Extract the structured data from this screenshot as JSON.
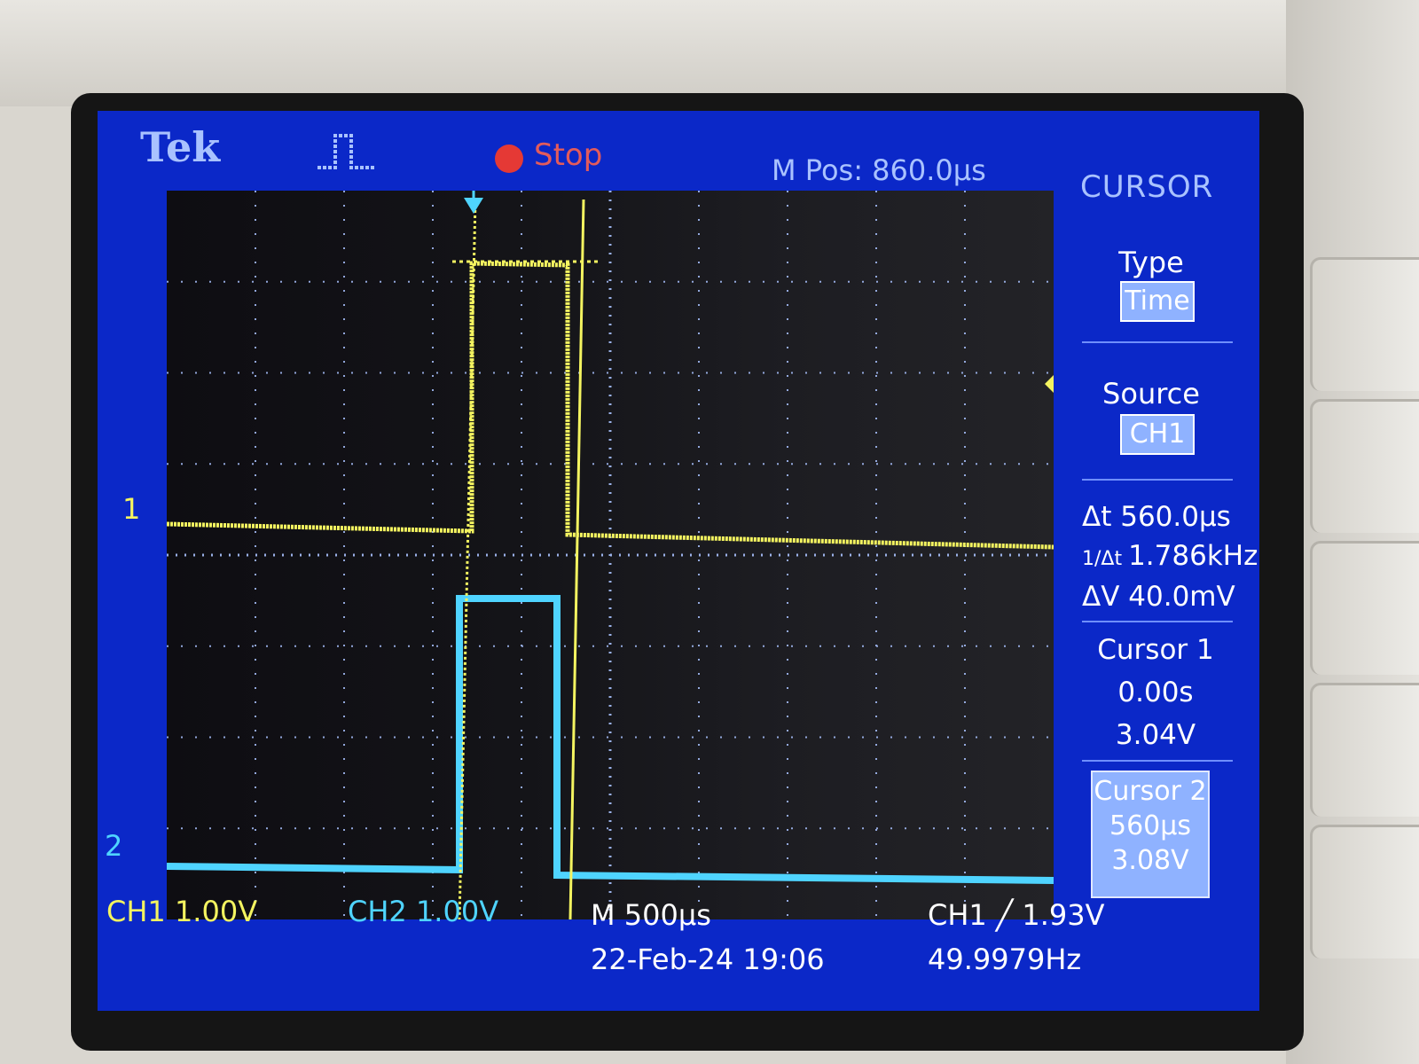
{
  "header": {
    "brand": "Tek",
    "acquisition_state": "Stop",
    "m_pos": "M Pos: 860.0µs"
  },
  "menu": {
    "title": "CURSOR",
    "type_label": "Type",
    "type_value": "Time",
    "source_label": "Source",
    "source_value": "CH1",
    "delta_t": "Δt 560.0µs",
    "inv_delta_t": "1.786kHz",
    "delta_v": "ΔV 40.0mV",
    "cursor1_label": "Cursor 1",
    "cursor1_time": "0.00s",
    "cursor1_volt": "3.04V",
    "cursor2_label": "Cursor 2",
    "cursor2_time": "560µs",
    "cursor2_volt": "3.08V"
  },
  "footer": {
    "ch1_scale": "CH1  1.00V",
    "ch2_scale": "CH2  1.00V",
    "timebase": "M 500µs",
    "datetime": "22-Feb-24 19:06",
    "trigger": "CH1 ╱ 1.93V",
    "frequency": "49.9979Hz"
  },
  "markers": {
    "ch1": "1",
    "ch2": "2"
  },
  "colors": {
    "ch1": "#f4f460",
    "ch2": "#4fd4ff",
    "screen": "#0b28c8"
  }
}
